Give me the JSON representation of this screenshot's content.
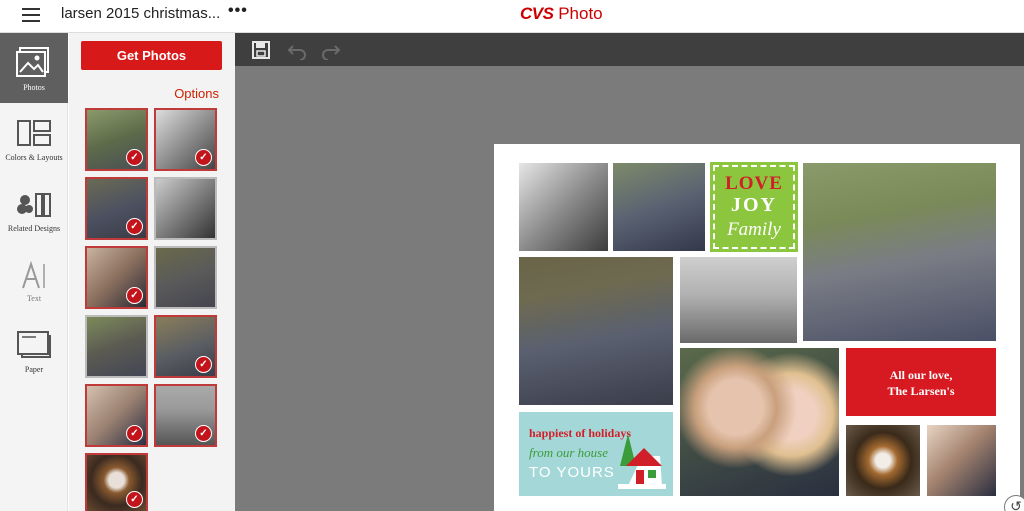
{
  "header": {
    "menu_icon": "hamburger-icon",
    "title": "larsen 2015 christmas...",
    "more": "•••",
    "brand_cvs": "CVS",
    "brand_photo": " Photo",
    "brand_color": "#cc0000"
  },
  "rail": {
    "items": [
      {
        "label": "Photos",
        "icon": "photos-icon",
        "active": true
      },
      {
        "label": "Colors & Layouts",
        "icon": "layouts-icon",
        "active": false
      },
      {
        "label": "Related Designs",
        "icon": "designs-icon",
        "active": false
      },
      {
        "label": "Text",
        "icon": "text-icon",
        "active": false
      },
      {
        "label": "Paper",
        "icon": "paper-icon",
        "active": false
      }
    ]
  },
  "panel": {
    "get_photos_label": "Get Photos",
    "options_label": "Options",
    "accent": "#d7191a",
    "check_mark": "✓",
    "thumbnails": [
      {
        "selected": true
      },
      {
        "selected": true
      },
      {
        "selected": true
      },
      {
        "selected": false
      },
      {
        "selected": true
      },
      {
        "selected": false
      },
      {
        "selected": false
      },
      {
        "selected": true
      },
      {
        "selected": true
      },
      {
        "selected": true
      },
      {
        "selected": true
      }
    ]
  },
  "toolbar": {
    "save_icon": "save-icon",
    "undo_icon": "undo-icon",
    "redo_icon": "redo-icon"
  },
  "card": {
    "love": "LOVE",
    "joy": "JOY",
    "family": "Family",
    "message_line1": "All our love,",
    "message_line2": "The Larsen's",
    "holiday_line1": "happiest of holidays",
    "holiday_line2": "from our house",
    "holiday_line3": "TO YOURS"
  }
}
